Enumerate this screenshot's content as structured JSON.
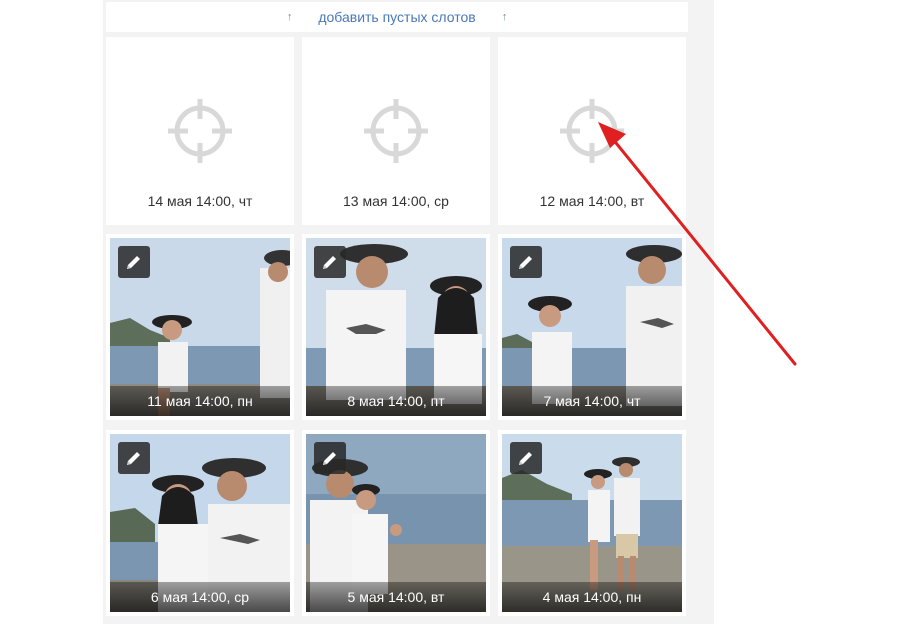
{
  "toolbar": {
    "add_slots_label": "добавить пустых слотов",
    "arrow_glyph": "↑"
  },
  "empty_slots": [
    {
      "label": "14 мая 14:00, чт"
    },
    {
      "label": "13 мая 14:00, ср"
    },
    {
      "label": "12 мая 14:00, вт"
    }
  ],
  "photos": [
    {
      "label": "11 мая 14:00, пн"
    },
    {
      "label": "8 мая 14:00, пт"
    },
    {
      "label": "7 мая 14:00, чт"
    },
    {
      "label": "6 мая 14:00, ср"
    },
    {
      "label": "5 мая 14:00, вт"
    },
    {
      "label": "4 мая 14:00, пн"
    }
  ],
  "icons": {
    "slot": "target-icon",
    "edit": "pencil-icon"
  },
  "colors": {
    "link": "#4a78b8",
    "annotation_arrow": "#e02020",
    "target": "#d8d8d8"
  }
}
